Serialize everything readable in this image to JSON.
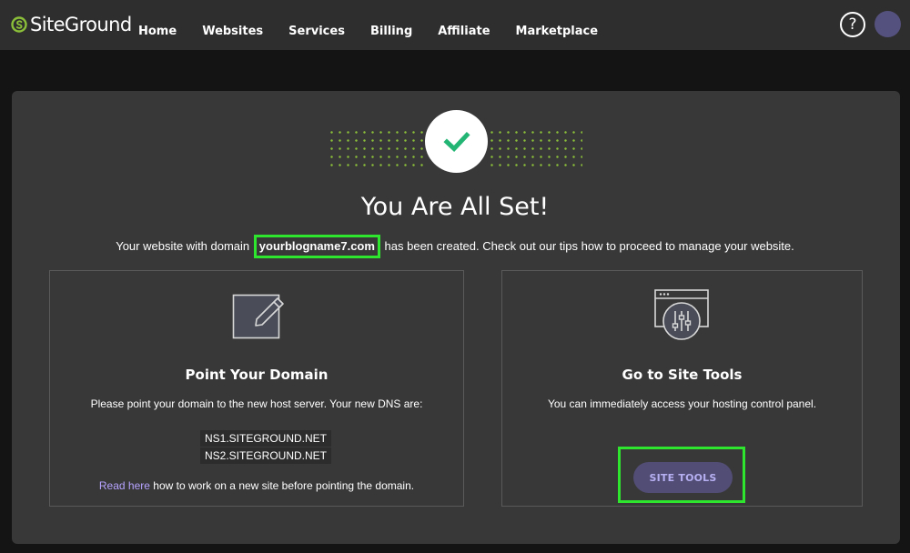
{
  "brand": {
    "name": "SiteGround"
  },
  "nav": {
    "items": [
      "Home",
      "Websites",
      "Services",
      "Billing",
      "Affiliate",
      "Marketplace"
    ]
  },
  "header": {
    "help_label": "?"
  },
  "success": {
    "title": "You Are All Set!",
    "subtitle_pre": "Your website with domain",
    "domain": "yourblogname7.com",
    "subtitle_post": "has been created. Check out our tips how to proceed to manage your website."
  },
  "point_domain": {
    "title": "Point Your Domain",
    "description": "Please point your domain to the new host server. Your new DNS are:",
    "dns": [
      "NS1.SITEGROUND.NET",
      "NS2.SITEGROUND.NET"
    ],
    "link_text": "Read here",
    "link_suffix": "how to work on a new site before pointing the domain."
  },
  "site_tools": {
    "title": "Go to Site Tools",
    "description": "You can immediately access your hosting control panel.",
    "button_label": "SITE TOOLS"
  },
  "colors": {
    "accent_green": "#2ee62e",
    "check_green": "#23b574",
    "button_bg": "#514d74",
    "link_purple": "#b6a3ff"
  }
}
